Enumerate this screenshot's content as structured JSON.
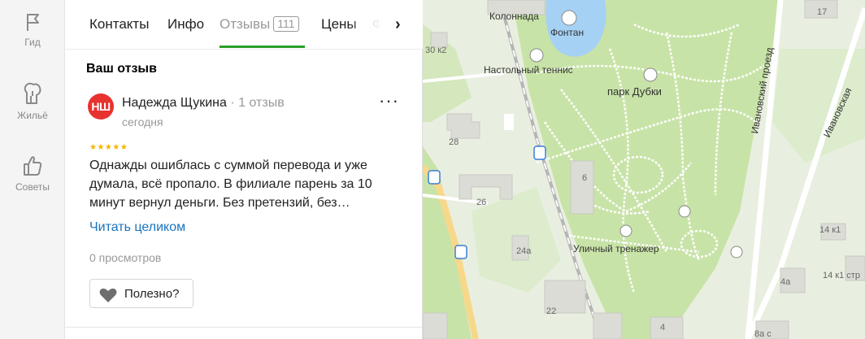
{
  "sidebar": {
    "items": [
      {
        "label": "Гид",
        "icon": "flag-icon"
      },
      {
        "label": "Жильё",
        "icon": "building-icon"
      },
      {
        "label": "Советы",
        "icon": "thumbs-up-icon"
      }
    ]
  },
  "tabs": {
    "items": [
      "Контакты",
      "Инфо",
      "Отзывы",
      "Цены",
      "Ф"
    ],
    "reviews_count": "111",
    "active": "Отзывы"
  },
  "review": {
    "section_title": "Ваш отзыв",
    "avatar_initials": "НШ",
    "author_name": "Надежда Щукина",
    "author_reviews": "1 отзыв",
    "date": "сегодня",
    "rating": 5,
    "stars": "★★★★★",
    "text": "Однажды ошиблась с суммой перевода и уже думала, всё пропало. В филиале парень за 10 минут вернул деньги. Без претензий, без…",
    "read_more": "Читать целиком",
    "views": "0 просмотров",
    "useful_label": "Полезно?"
  },
  "map": {
    "labels": {
      "colonnade": "Колоннада",
      "fountain": "Фонтан",
      "tennis": "Настольный теннис",
      "park": "парк Дубки",
      "gym": "Уличный тренажер",
      "street1": "Ивановский проезд",
      "street2": "Ивановская"
    },
    "house_numbers": {
      "h30k2": "30 к2",
      "h28": "28",
      "h26": "26",
      "h6": "6",
      "h24a": "24а",
      "h22": "22",
      "h17": "17",
      "h14k1": "14 к1",
      "h14k1b": "14 к1 стр",
      "h4a": "4а",
      "h4": "4",
      "h8a": "8а с"
    },
    "colors": {
      "park": "#c8e3a7",
      "land": "#e9efe0",
      "building": "#dcdcd7",
      "water": "#a5d1f5",
      "road": "#ffffff",
      "main_road": "#f7d88a",
      "rail": "#b5b5b5"
    }
  },
  "colors": {
    "accent": "#2a9e25",
    "avatar": "#e8322f",
    "link": "#1a73bd",
    "star": "#f6b400"
  }
}
